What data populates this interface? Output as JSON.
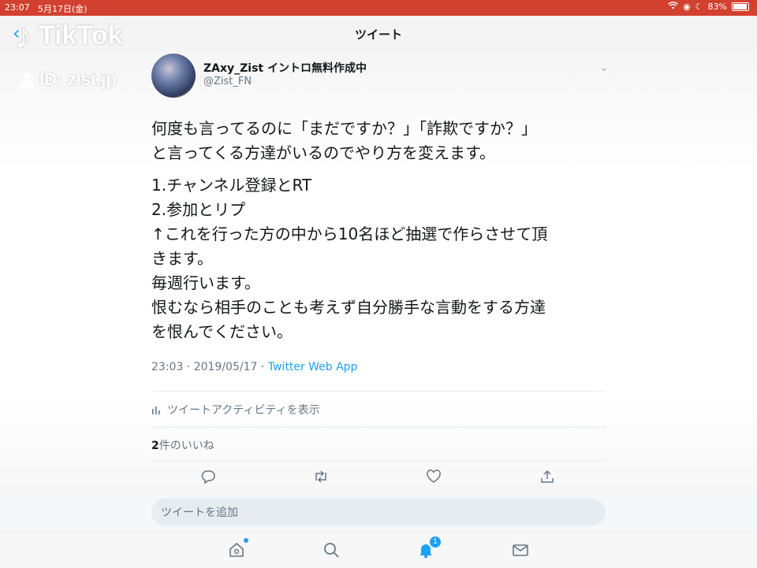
{
  "status_bar": {
    "time": "23:07",
    "date": "5月17日(金)",
    "battery": "83%"
  },
  "nav": {
    "title": "ツイート"
  },
  "watermark": {
    "brand": "TikTok",
    "id": "ID: zlst.jp"
  },
  "author": {
    "name": "ZAxy_Zist イントロ無料作成中",
    "handle": "@Zist_FN"
  },
  "tweet": {
    "para1": [
      "何度も言ってるのに「まだですか？」「詐欺ですか？」",
      "と言ってくる方達がいるのでやり方を変えます。"
    ],
    "para2": [
      "1.チャンネル登録とRT",
      "2.参加とリプ",
      "↑これを行った方の中から10名ほど抽選で作らさせて頂",
      "きます。",
      "毎週行います。",
      "恨むなら相手のことも考えず自分勝手な言動をする方達",
      "を恨んでください。"
    ],
    "time": "23:03 · 2019/05/17 · ",
    "source": "Twitter Web App"
  },
  "activity": {
    "label": "ツイートアクティビティを表示"
  },
  "likes": {
    "count": "2",
    "label": "件のいいね"
  },
  "reply": {
    "placeholder": "ツイートを追加"
  },
  "tabbar": {
    "notification_badge": "1"
  },
  "colors": {
    "accent": "#1da1f2",
    "statusbar": "#d2412f"
  }
}
